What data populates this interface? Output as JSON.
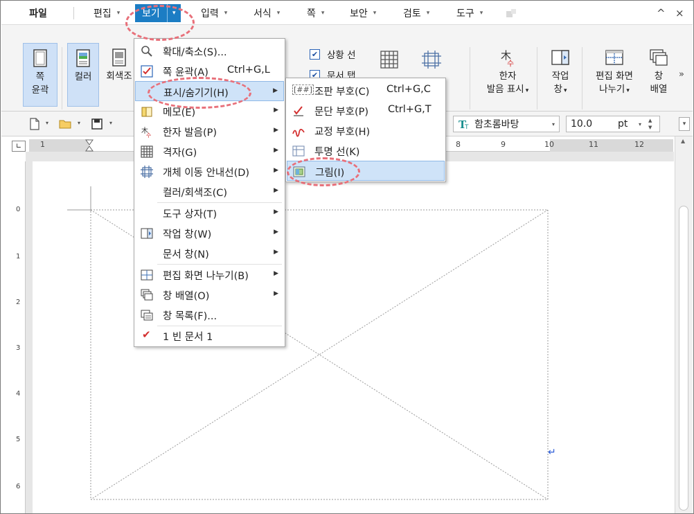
{
  "menubar": {
    "file": "파일",
    "items": [
      "편집",
      "보기",
      "입력",
      "서식",
      "쪽",
      "보안",
      "검토",
      "도구"
    ],
    "active": "보기",
    "controls": {
      "collapse": "^",
      "close": "×"
    }
  },
  "ribbon": {
    "page_outline_line1": "쪽",
    "page_outline_line2": "윤곽",
    "color": "컬러",
    "grayscale": "회색조",
    "status_line": "상황 선",
    "doc_tab": "문서 탭",
    "hanja_line1": "한자",
    "hanja_line2": "발음 표시",
    "task_pane_line1": "작업",
    "task_pane_line2": "창",
    "split_line1": "편집 화면",
    "split_line2": "나누기",
    "arrange_line1": "창",
    "arrange_line2": "배열",
    "more": "»"
  },
  "toolbar": {
    "font": "함초롬바탕",
    "size": "10.0",
    "unit": "pt"
  },
  "ruler": {
    "numbers": [
      "1",
      "8",
      "9",
      "10",
      "11",
      "12"
    ],
    "vnumbers": [
      "0",
      "1",
      "2",
      "3",
      "4",
      "5",
      "6"
    ]
  },
  "view_menu": {
    "items": [
      {
        "label": "확대/축소(S)...",
        "shortcut": "",
        "submenu": false
      },
      {
        "label": "쪽 윤곽(A)",
        "shortcut": "Ctrl+G,L",
        "submenu": false
      },
      {
        "label": "표시/숨기기(H)",
        "shortcut": "",
        "submenu": true
      },
      {
        "label": "메모(E)",
        "shortcut": "",
        "submenu": true
      },
      {
        "label": "한자 발음(P)",
        "shortcut": "",
        "submenu": true
      },
      {
        "label": "격자(G)",
        "shortcut": "",
        "submenu": true
      },
      {
        "label": "개체 이동 안내선(D)",
        "shortcut": "",
        "submenu": true
      },
      {
        "label": "컬러/회색조(C)",
        "shortcut": "",
        "submenu": true
      },
      {
        "label": "도구 상자(T)",
        "shortcut": "",
        "submenu": true
      },
      {
        "label": "작업 창(W)",
        "shortcut": "",
        "submenu": true
      },
      {
        "label": "문서 창(N)",
        "shortcut": "",
        "submenu": true
      },
      {
        "label": "편집 화면 나누기(B)",
        "shortcut": "",
        "submenu": true
      },
      {
        "label": "창 배열(O)",
        "shortcut": "",
        "submenu": true
      },
      {
        "label": "창 목록(F)...",
        "shortcut": "",
        "submenu": false
      },
      {
        "label": "1 빈 문서 1",
        "shortcut": "",
        "submenu": false
      }
    ]
  },
  "show_hide_menu": {
    "items": [
      {
        "label": "조판 부호(C)",
        "shortcut": "Ctrl+G,C"
      },
      {
        "label": "문단 부호(P)",
        "shortcut": "Ctrl+G,T"
      },
      {
        "label": "교정 부호(H)",
        "shortcut": ""
      },
      {
        "label": "투명 선(K)",
        "shortcut": ""
      },
      {
        "label": "그림(I)",
        "shortcut": ""
      }
    ]
  },
  "colors": {
    "accent": "#1c7dc4",
    "highlight": "#cfe3f8",
    "annotation": "#e8707a"
  }
}
